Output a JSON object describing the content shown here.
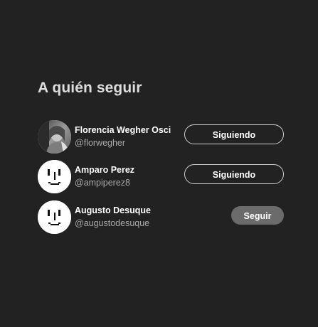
{
  "section": {
    "title": "A quién seguir"
  },
  "users": [
    {
      "name": "Florencia Wegher Osci",
      "handle": "@florwegher",
      "avatar": "photo-avatar",
      "button_label": "Siguiendo",
      "following": true
    },
    {
      "name": "Amparo Perez",
      "handle": "@ampiperez8",
      "avatar": "default-face-avatar",
      "button_label": "Siguiendo",
      "following": true
    },
    {
      "name": "Augusto Desuque",
      "handle": "@augustodesuque",
      "avatar": "default-face-avatar",
      "button_label": "Seguir",
      "following": false
    }
  ],
  "colors": {
    "background": "#222222",
    "title": "#dedede",
    "handle": "#a8a8a8",
    "follow_button": "#6b6b6b",
    "following_border": "#cfcfcf"
  }
}
